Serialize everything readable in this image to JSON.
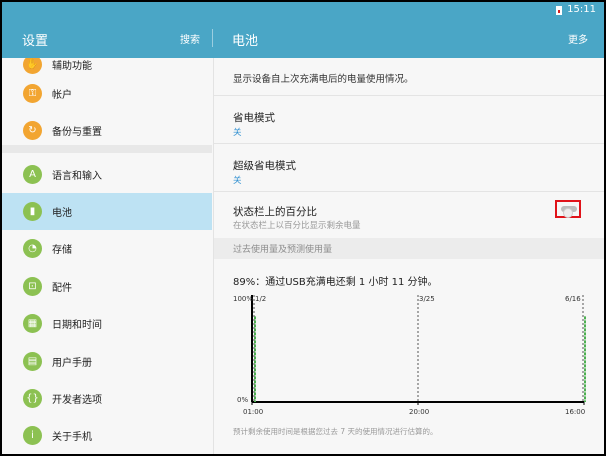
{
  "status_bar": {
    "time": "15:11"
  },
  "app_bar": {
    "title_left": "设置",
    "search": "搜索",
    "title_right": "电池",
    "more": "更多"
  },
  "sidebar": {
    "items": [
      {
        "label": "辅助功能",
        "icon": "accessibility-icon",
        "glyph": "✋"
      },
      {
        "label": "帐户",
        "icon": "key-icon",
        "glyph": "⚿"
      },
      {
        "label": "备份与重置",
        "icon": "backup-icon",
        "glyph": "↻"
      },
      {
        "label": "语言和输入",
        "icon": "language-icon",
        "glyph": "A"
      },
      {
        "label": "电池",
        "icon": "battery-icon",
        "glyph": "▮"
      },
      {
        "label": "存储",
        "icon": "storage-icon",
        "glyph": "◔"
      },
      {
        "label": "配件",
        "icon": "accessory-icon",
        "glyph": "⊡"
      },
      {
        "label": "日期和时间",
        "icon": "calendar-icon",
        "glyph": "▦"
      },
      {
        "label": "用户手册",
        "icon": "manual-icon",
        "glyph": "▤"
      },
      {
        "label": "开发者选项",
        "icon": "developer-icon",
        "glyph": "{}"
      },
      {
        "label": "关于手机",
        "icon": "info-icon",
        "glyph": "i"
      }
    ],
    "selected": "电池"
  },
  "battery": {
    "description": "显示设备自上次充满电后的电量使用情况。",
    "power_saving": {
      "title": "省电模式",
      "value": "关"
    },
    "ultra_power_saving": {
      "title": "超级省电模式",
      "value": "关"
    },
    "percent_in_status_bar": {
      "title": "状态栏上的百分比",
      "subtitle": "在状态栏上以百分比显示剩余电量",
      "enabled": false
    },
    "section_header": "过去使用量及预测使用量",
    "estimate": "89%：通过USB充满电还剩 1 小时 11 分钟。",
    "footnote": "预计剩余使用时间是根据您过去 7 天的使用情况进行估算的。"
  },
  "chart_data": {
    "type": "area",
    "y_tick_labels": [
      "100%",
      "0%"
    ],
    "ylim": [
      0,
      100
    ],
    "date_markers": [
      "1/2",
      "3/25",
      "6/16"
    ],
    "x_tick_labels": [
      "01:00",
      "20:00",
      "16:00"
    ],
    "series": [
      {
        "values": [
          100,
          100,
          80
        ],
        "x": [
          "1/2",
          "1/2",
          "1/2"
        ]
      },
      {
        "values": [
          80,
          89
        ],
        "x": [
          "6/16",
          "6/16"
        ]
      }
    ],
    "colors": {
      "usage": "#000000",
      "charging": "#4caf50"
    }
  },
  "colors": {
    "accent": "#4aa6c6",
    "selected_bg": "#bde2f3",
    "link": "#2f8fd0",
    "highlight": "#e0131a"
  }
}
